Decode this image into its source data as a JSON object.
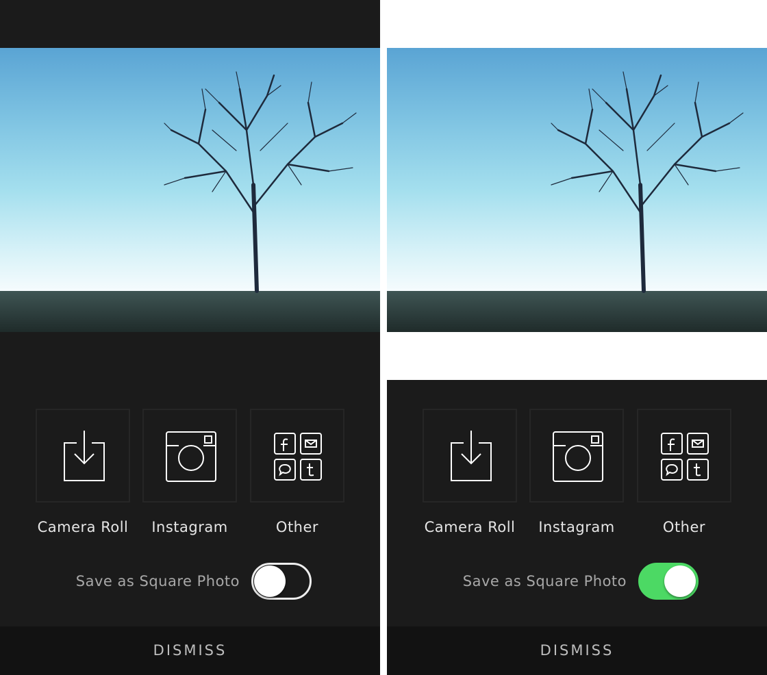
{
  "panels": [
    {
      "options": [
        {
          "label": "Camera Roll",
          "icon": "download-icon"
        },
        {
          "label": "Instagram",
          "icon": "instagram-icon"
        },
        {
          "label": "Other",
          "icon": "social-share-icon"
        }
      ],
      "save_square_label": "Save as Square Photo",
      "save_square_on": false,
      "dismiss_label": "DISMISS"
    },
    {
      "options": [
        {
          "label": "Camera Roll",
          "icon": "download-icon"
        },
        {
          "label": "Instagram",
          "icon": "instagram-icon"
        },
        {
          "label": "Other",
          "icon": "social-share-icon"
        }
      ],
      "save_square_label": "Save as Square Photo",
      "save_square_on": true,
      "dismiss_label": "DISMISS"
    }
  ],
  "colors": {
    "sheet": "#1b1b1b",
    "toggle_on": "#4cd964",
    "dismiss_bar": "#121212"
  }
}
